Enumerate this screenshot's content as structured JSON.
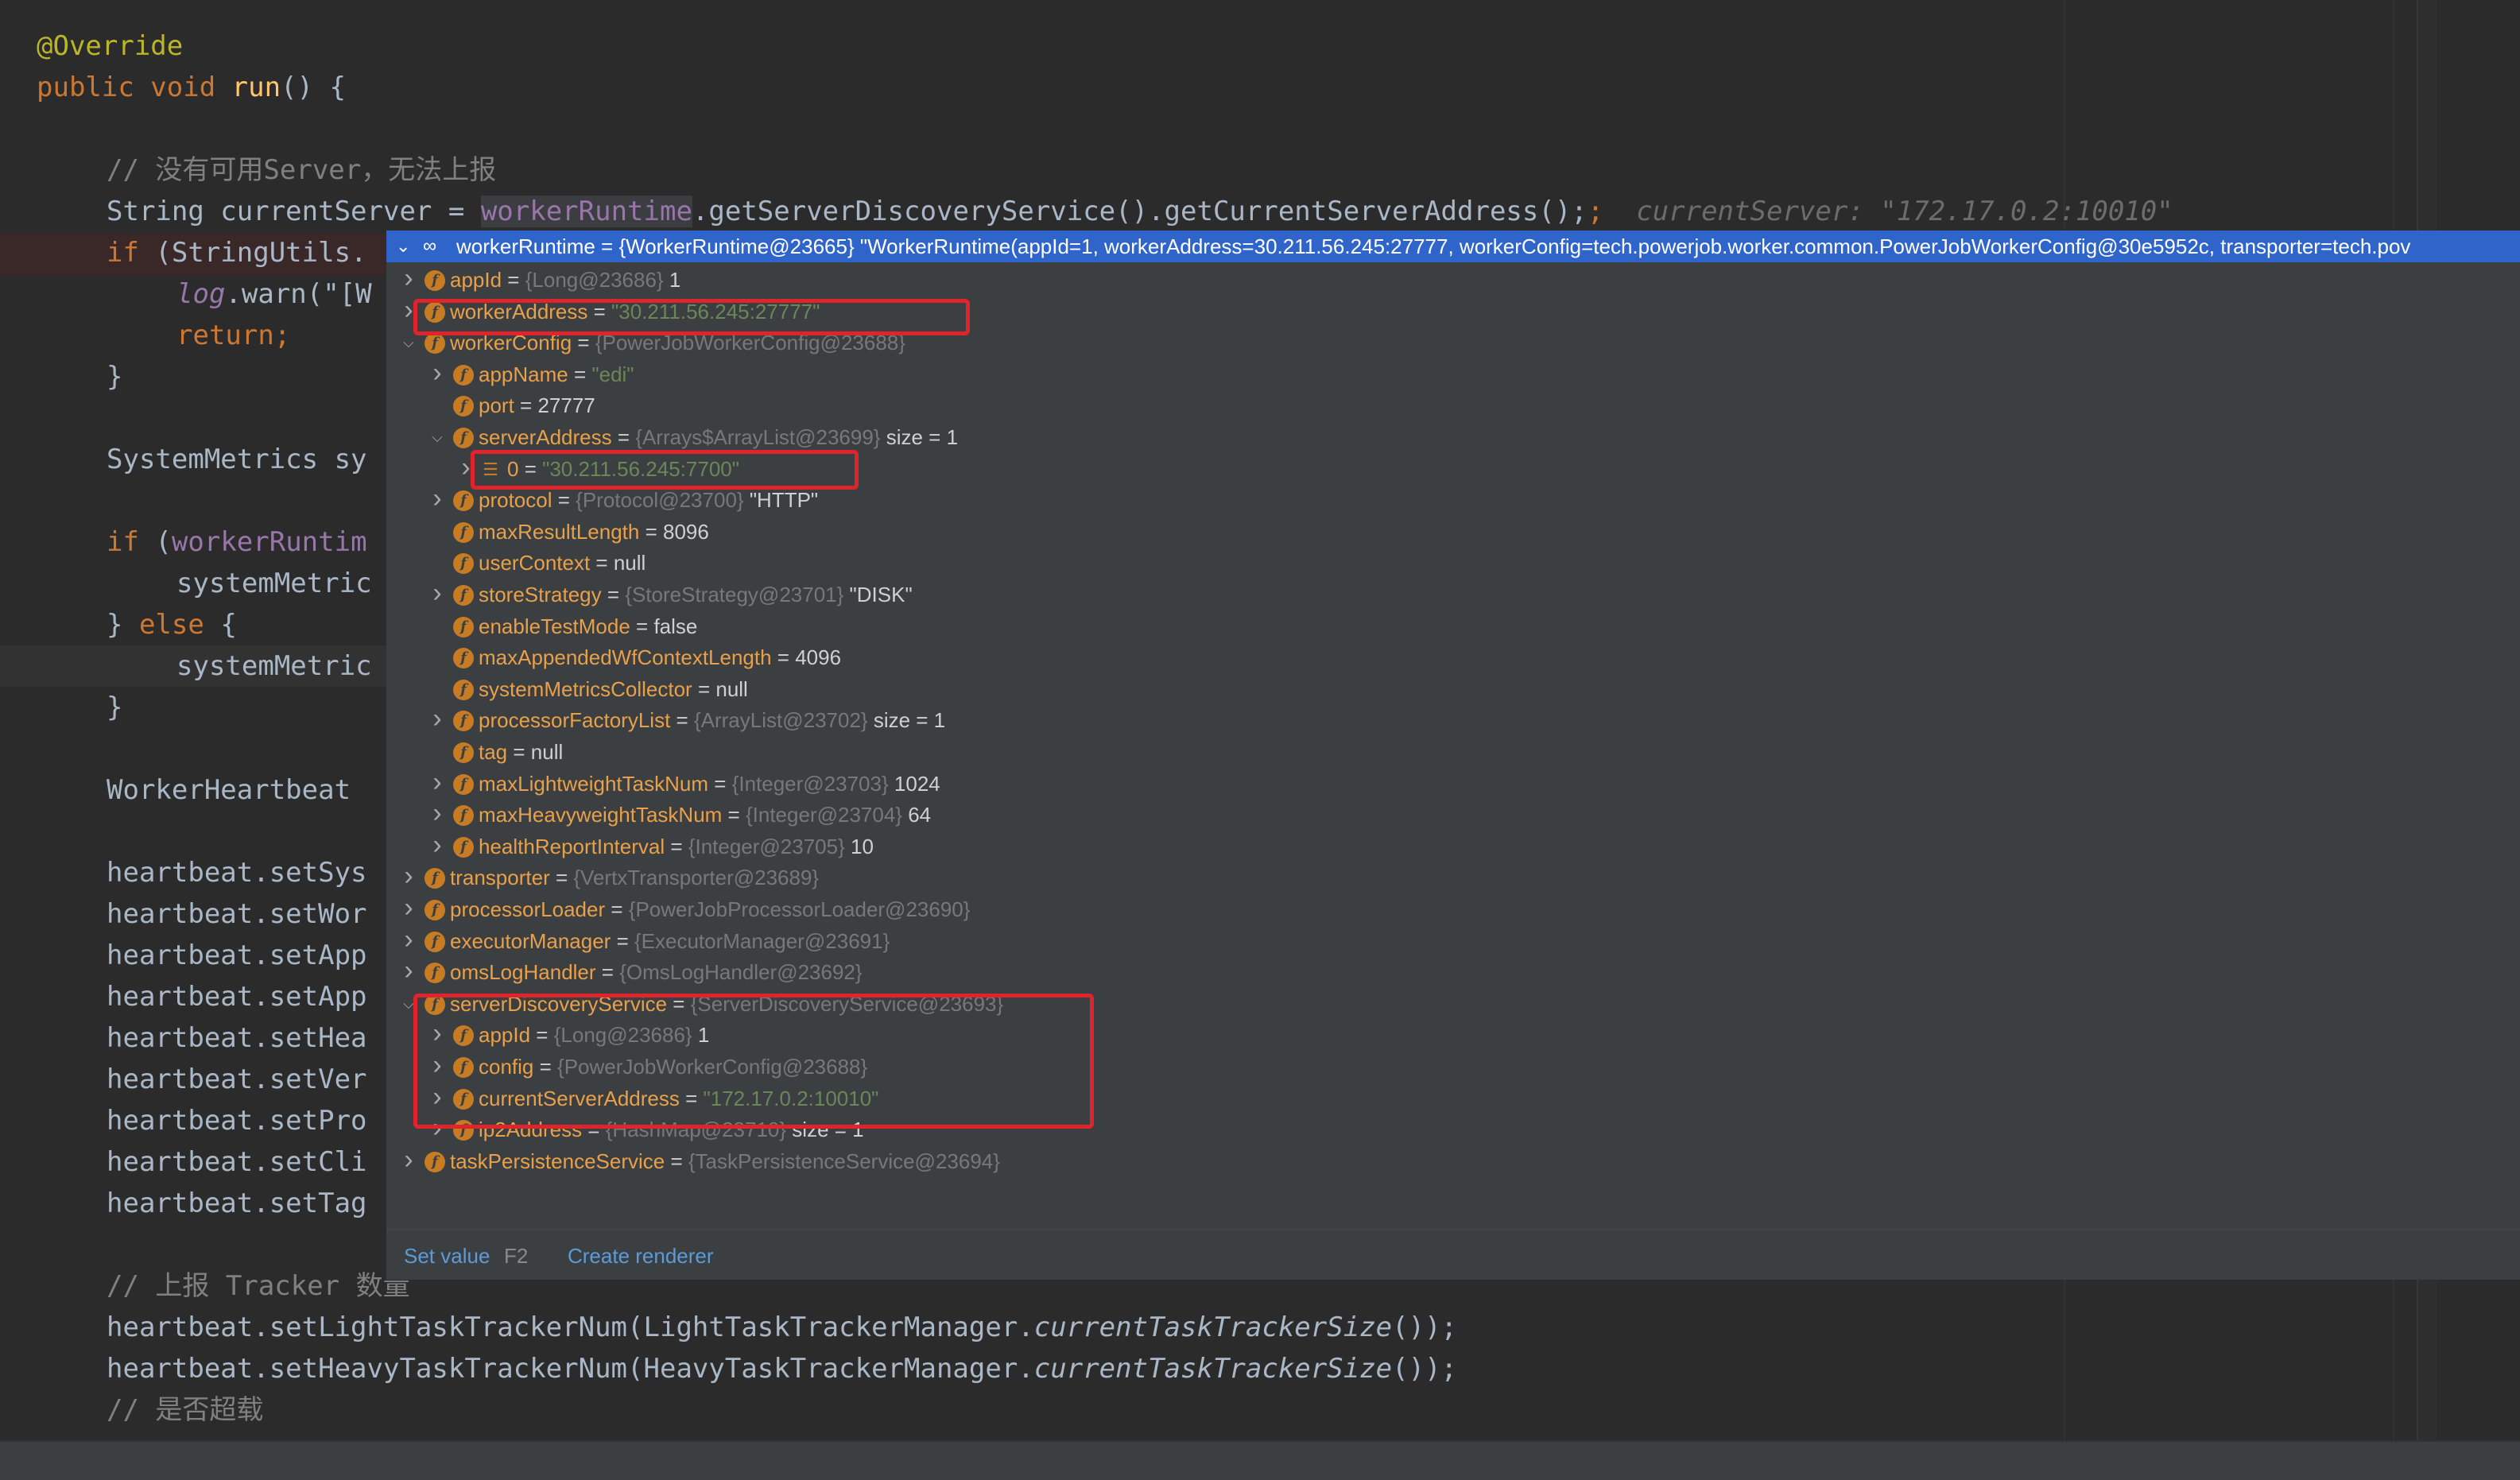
{
  "editor": {
    "annotation": "@Override",
    "method_decl": {
      "kw": "public void",
      "name": "run",
      "rest": "() {"
    },
    "comment_no_server": "// 没有可用Server，无法上报",
    "current_server_line": {
      "prefix": "String currentServer = ",
      "ref": "workerRuntime",
      "rest": ".getServerDiscoveryService().getCurrentServerAddress();",
      "hint": "currentServer: \"172.17.0.2:10010\""
    },
    "if_line": {
      "kw": "if",
      "rest": " (StringUtils."
    },
    "log_line": {
      "obj": "log",
      "rest": ".warn(\"[W"
    },
    "return_line": "return;",
    "close_brace": "}",
    "metrics_line": "SystemMetrics sy",
    "if_runtime": {
      "kw": "if",
      "rest": " (",
      "fld": "workerRuntim"
    },
    "metric_line1": "systemMetric",
    "else_line": {
      "brace": "} ",
      "kw": "else",
      "rest": " {"
    },
    "metric_line2": "systemMetric",
    "close_brace2": "}",
    "heartbeat_decl": "WorkerHeartbeat ",
    "heartbeat_calls": [
      "heartbeat.setSys",
      "heartbeat.setWor",
      "heartbeat.setApp",
      "heartbeat.setApp",
      "heartbeat.setHea",
      "heartbeat.setVer",
      "heartbeat.setPro",
      "heartbeat.setCli",
      "heartbeat.setTag"
    ],
    "comment_tracker": "// 上报 Tracker 数量",
    "light_line": {
      "prefix": "heartbeat.setLightTaskTrackerNum(LightTaskTrackerManager.",
      "call": "currentTaskTrackerSize",
      "rest": "());"
    },
    "heavy_line": {
      "prefix": "heartbeat.setHeavyTaskTrackerNum(HeavyTaskTrackerManager.",
      "call": "currentTaskTrackerSize",
      "rest": "());"
    },
    "comment_overload": "// 是否超载"
  },
  "popup": {
    "header": "workerRuntime = {WorkerRuntime@23665} \"WorkerRuntime(appId=1, workerAddress=30.211.56.245:27777, workerConfig=tech.powerjob.worker.common.PowerJobWorkerConfig@30e5952c, transporter=tech.pov",
    "rows": [
      {
        "name": "appId",
        "eq": " = ",
        "type": "{Long@23686}",
        "value": " 1",
        "str": ""
      },
      {
        "name": "workerAddress",
        "eq": " = ",
        "type": "",
        "value": "",
        "str": "\"30.211.56.245:27777\""
      },
      {
        "name": "workerConfig",
        "eq": " = ",
        "type": "{PowerJobWorkerConfig@23688}",
        "value": "",
        "str": ""
      },
      {
        "name": "appName",
        "eq": " = ",
        "type": "",
        "value": "",
        "str": "\"edi\""
      },
      {
        "name": "port",
        "eq": " = ",
        "type": "",
        "value": "27777",
        "str": ""
      },
      {
        "name": "serverAddress",
        "eq": " = ",
        "type": "{Arrays$ArrayList@23699}",
        "value": "  size = 1",
        "str": ""
      },
      {
        "name": "0",
        "eq": " = ",
        "type": "",
        "value": "",
        "str": "\"30.211.56.245:7700\""
      },
      {
        "name": "protocol",
        "eq": " = ",
        "type": "{Protocol@23700}",
        "value": " \"HTTP\"",
        "str": ""
      },
      {
        "name": "maxResultLength",
        "eq": " = ",
        "type": "",
        "value": "8096",
        "str": ""
      },
      {
        "name": "userContext",
        "eq": " = ",
        "type": "",
        "value": "null",
        "str": ""
      },
      {
        "name": "storeStrategy",
        "eq": " = ",
        "type": "{StoreStrategy@23701}",
        "value": " \"DISK\"",
        "str": ""
      },
      {
        "name": "enableTestMode",
        "eq": " = ",
        "type": "",
        "value": "false",
        "str": ""
      },
      {
        "name": "maxAppendedWfContextLength",
        "eq": " = ",
        "type": "",
        "value": "4096",
        "str": ""
      },
      {
        "name": "systemMetricsCollector",
        "eq": " = ",
        "type": "",
        "value": "null",
        "str": ""
      },
      {
        "name": "processorFactoryList",
        "eq": " = ",
        "type": "{ArrayList@23702}",
        "value": "  size = 1",
        "str": ""
      },
      {
        "name": "tag",
        "eq": " = ",
        "type": "",
        "value": "null",
        "str": ""
      },
      {
        "name": "maxLightweightTaskNum",
        "eq": " = ",
        "type": "{Integer@23703}",
        "value": " 1024",
        "str": ""
      },
      {
        "name": "maxHeavyweightTaskNum",
        "eq": " = ",
        "type": "{Integer@23704}",
        "value": " 64",
        "str": ""
      },
      {
        "name": "healthReportInterval",
        "eq": " = ",
        "type": "{Integer@23705}",
        "value": " 10",
        "str": ""
      },
      {
        "name": "transporter",
        "eq": " = ",
        "type": "{VertxTransporter@23689}",
        "value": "",
        "str": ""
      },
      {
        "name": "processorLoader",
        "eq": " = ",
        "type": "{PowerJobProcessorLoader@23690}",
        "value": "",
        "str": ""
      },
      {
        "name": "executorManager",
        "eq": " = ",
        "type": "{ExecutorManager@23691}",
        "value": "",
        "str": ""
      },
      {
        "name": "omsLogHandler",
        "eq": " = ",
        "type": "{OmsLogHandler@23692}",
        "value": "",
        "str": ""
      },
      {
        "name": "serverDiscoveryService",
        "eq": " = ",
        "type": "{ServerDiscoveryService@23693}",
        "value": "",
        "str": ""
      },
      {
        "name": "appId",
        "eq": " = ",
        "type": "{Long@23686}",
        "value": " 1",
        "str": ""
      },
      {
        "name": "config",
        "eq": " = ",
        "type": "{PowerJobWorkerConfig@23688}",
        "value": "",
        "str": ""
      },
      {
        "name": "currentServerAddress",
        "eq": " = ",
        "type": "",
        "value": "",
        "str": "\"172.17.0.2:10010\""
      },
      {
        "name": "ip2Address",
        "eq": " = ",
        "type": "{HashMap@23710}",
        "value": "  size = 1",
        "str": ""
      },
      {
        "name": "taskPersistenceService",
        "eq": " = ",
        "type": "{TaskPersistenceService@23694}",
        "value": "",
        "str": ""
      }
    ],
    "footer": {
      "set_value": "Set value",
      "set_value_key": "F2",
      "create_renderer": "Create renderer"
    }
  }
}
